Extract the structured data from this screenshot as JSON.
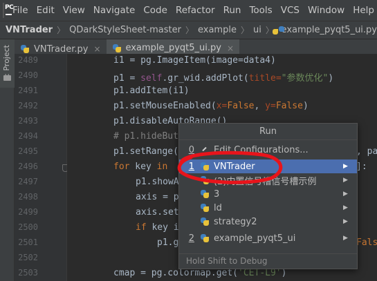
{
  "menubar": {
    "logo_text": "PC",
    "items": [
      "File",
      "Edit",
      "View",
      "Navigate",
      "Code",
      "Refactor",
      "Run",
      "Tools",
      "VCS",
      "Window",
      "Help"
    ]
  },
  "breadcrumb": {
    "project": "VNTrader",
    "path": [
      "QDarkStyleSheet-master",
      "example",
      "ui"
    ],
    "file": "example_pyqt5_ui.py"
  },
  "left_stripe": {
    "project_label": "1: Project"
  },
  "tabs": [
    {
      "label": "VNTrader.py",
      "close": "×"
    },
    {
      "label": "example_pyqt5_ui.py",
      "close": "×"
    }
  ],
  "editor": {
    "line_numbers": [
      "2489",
      "2490",
      "2491",
      "2492",
      "2493",
      "2494",
      "2495",
      "2496",
      "2497",
      "2498",
      "2499",
      "2500",
      "2501",
      "2502",
      "2503"
    ],
    "lines": {
      "l2489": "i1 = pg.ImageItem(image=data4)",
      "l2490_a": "p1 = ",
      "l2490_b": "self",
      "l2490_c": ".gr_wid.addPlot(",
      "l2490_d": "title=",
      "l2490_e": "\"参数优化\"",
      "l2490_f": ")",
      "l2491": "p1.addItem(i1)",
      "l2492_a": "p1.setMouseEnabled(",
      "l2492_b": "x=",
      "l2492_c": "False",
      "l2492_d": ", ",
      "l2492_e": "y=",
      "l2492_f": "False",
      "l2492_g": ")",
      "l2493": "p1.disableAutoRange()",
      "l2494": "# p1.hideBut",
      "l2495_a": "p1.setRange(",
      "l2495_b": ", pa",
      "l2496_a": "for",
      "l2496_b": " key ",
      "l2496_c": "in",
      "l2496_d": "]:",
      "l2497": "p1.showA",
      "l2498": "axis = p",
      "l2499": "axis.set",
      "l2500_a": "if",
      "l2500_b": " key i",
      "l2501_a": "p1.g",
      "l2501_b": "Fals",
      "l2503_a": "cmap = pg.colormap.get(",
      "l2503_b": "'CET-L9'",
      "l2503_c": ")"
    }
  },
  "run_popup": {
    "title": "Run",
    "items": [
      {
        "number": "0",
        "label": "Edit Configurations...",
        "arrow": ""
      },
      {
        "number": "1",
        "label": "VNTrader",
        "arrow": "▶"
      },
      {
        "number": "",
        "label": "(2)内置信号槽信号槽示例",
        "arrow": "▶"
      },
      {
        "number": "",
        "label": "3",
        "arrow": "▶"
      },
      {
        "number": "",
        "label": "ld",
        "arrow": "▶"
      },
      {
        "number": "",
        "label": "strategy2",
        "arrow": "▶"
      },
      {
        "number": "2",
        "label": "example_pyqt5_ui",
        "arrow": "▶"
      }
    ],
    "footer": "Hold Shift to Debug"
  },
  "colors": {
    "annotation": "#e8141b",
    "selection": "#4b6eaf"
  }
}
